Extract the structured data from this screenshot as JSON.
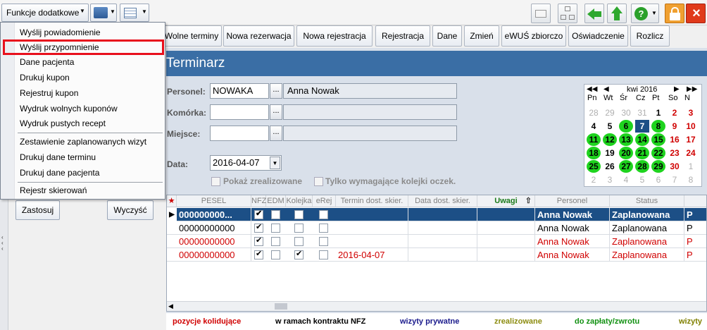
{
  "toolbar": {
    "functions_label": "Funkcje dodatkowe",
    "icons": [
      "printer-icon",
      "layout-icon",
      "envelope-icon",
      "network-icon",
      "back-arrow-icon",
      "up-arrow-icon",
      "help-icon",
      "lock-icon",
      "close-icon"
    ]
  },
  "actions": [
    "Wolne terminy",
    "Nowa rezerwacja",
    "Nowa rejestracja",
    "Rejestracja",
    "Dane",
    "Zmień",
    "eWUŚ zbiorczo",
    "Oświadczenie",
    "Rozlicz"
  ],
  "menu": {
    "items": [
      "Wyślij powiadomienie",
      "Wyślij przypomnienie",
      "Dane pacjenta",
      "Drukuj kupon",
      "Rejestruj kupon",
      "Wydruk wolnych kuponów",
      "Wydruk pustych recept",
      "Zestawienie zaplanowanych wizyt",
      "Drukuj dane terminu",
      "Drukuj dane pacjenta",
      "Rejestr skierowań"
    ],
    "highlighted": "Wyślij przypomnienie"
  },
  "left": {
    "apply_label": "Zastosuj",
    "clear_label": "Wyczyść"
  },
  "main": {
    "title": "Terminarz",
    "personel_label": "Personel:",
    "personel_code": "NOWAKA",
    "personel_name": "Anna Nowak",
    "komorka_label": "Komórka:",
    "miejsce_label": "Miejsce:",
    "data_label": "Data:",
    "date_value": "2016-04-07",
    "show_done_label": "Pokaż zrealizowane",
    "queue_only_label": "Tylko wymagające kolejki oczek."
  },
  "calendar": {
    "month_label": "kwi 2016",
    "weekdays": [
      "Pn",
      "Wt",
      "Śr",
      "Cz",
      "Pt",
      "So",
      "N"
    ],
    "days": [
      [
        "28",
        "29",
        "30",
        "31",
        "1",
        "2",
        "3"
      ],
      [
        "4",
        "5",
        "6",
        "7",
        "8",
        "9",
        "10"
      ],
      [
        "11",
        "12",
        "13",
        "14",
        "15",
        "16",
        "17"
      ],
      [
        "18",
        "19",
        "20",
        "21",
        "22",
        "23",
        "24"
      ],
      [
        "25",
        "26",
        "27",
        "28",
        "29",
        "30",
        "1"
      ],
      [
        "2",
        "3",
        "4",
        "5",
        "6",
        "7",
        "8"
      ]
    ]
  },
  "grid": {
    "headers": [
      "PESEL",
      "NFZ",
      "EDM",
      "Kolejka",
      "eRej",
      "Termin dost. skier.",
      "Data dost. skier.",
      "Uwagi",
      "Personel",
      "Status"
    ],
    "rows": [
      {
        "pesel": "000000000...",
        "nfz": true,
        "edm": false,
        "kolejka": false,
        "erej": false,
        "termin": "",
        "personel": "Anna Nowak",
        "status": "Zaplanowana",
        "extra": "P"
      },
      {
        "pesel": "00000000000",
        "nfz": true,
        "edm": false,
        "kolejka": false,
        "erej": false,
        "termin": "",
        "personel": "Anna Nowak",
        "status": "Zaplanowana",
        "extra": "P"
      },
      {
        "pesel": "00000000000",
        "nfz": true,
        "edm": false,
        "kolejka": false,
        "erej": false,
        "termin": "",
        "personel": "Anna Nowak",
        "status": "Zaplanowana",
        "extra": "P"
      },
      {
        "pesel": "00000000000",
        "nfz": true,
        "edm": false,
        "kolejka": true,
        "erej": false,
        "termin": "2016-04-07",
        "personel": "Anna Nowak",
        "status": "Zaplanowana",
        "extra": "P"
      }
    ]
  },
  "legend": [
    {
      "label": "pozycje kolidujące",
      "color": "#d00000"
    },
    {
      "label": "w ramach kontraktu NFZ",
      "color": "#000000"
    },
    {
      "label": "wizyty prywatne",
      "color": "#1a1a8c"
    },
    {
      "label": "zrealizowane",
      "color": "#8c8c10"
    },
    {
      "label": "do zapłaty/zwrotu",
      "color": "#109010"
    },
    {
      "label": "wizyty",
      "color": "#808000"
    }
  ]
}
